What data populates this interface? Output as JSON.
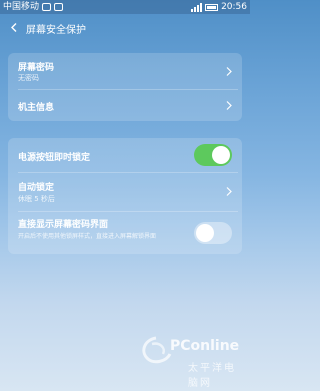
{
  "status_bar": {
    "carrier": "中国移动",
    "time": "20:56"
  },
  "header": {
    "title": "屏幕安全保护"
  },
  "groups": [
    {
      "items": [
        {
          "label": "屏幕密码",
          "sublabel": "无密码",
          "control": "chevron"
        },
        {
          "label": "机主信息",
          "control": "chevron"
        }
      ]
    },
    {
      "items": [
        {
          "label": "电源按钮即时锁定",
          "control": "toggle",
          "checked": true
        },
        {
          "label": "自动锁定",
          "sublabel": "休眠 5 秒后",
          "control": "chevron"
        },
        {
          "label": "直接显示屏幕密码界面",
          "sublabel": "开启后不使用其他锁屏样式，直接进入屏幕解锁界面",
          "control": "toggle",
          "checked": false
        }
      ]
    }
  ],
  "watermark": {
    "brand": "PConline",
    "chinese": "太平洋电脑网"
  },
  "colors": {
    "toggle_on": "#5dc95d",
    "background_top": "#4f8fc7",
    "background_bottom": "#d8e6f3"
  }
}
